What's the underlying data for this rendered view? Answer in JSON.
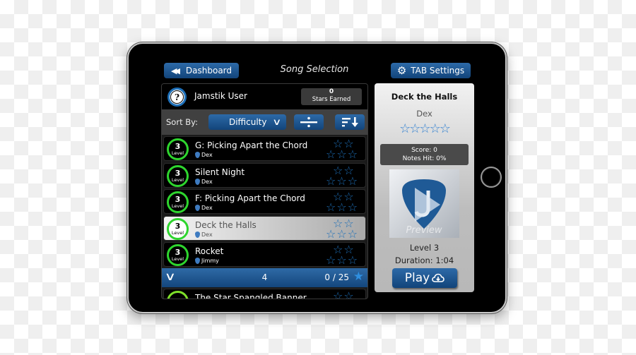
{
  "header": {
    "back_label": "Dashboard",
    "title": "Song Selection",
    "settings_label": "TAB Settings"
  },
  "user": {
    "name": "Jamstik User",
    "stars_earned_count": "0",
    "stars_earned_label": "Stars Earned"
  },
  "sort": {
    "label": "Sort By:",
    "selected": "Difficulty"
  },
  "songs": [
    {
      "level": "3",
      "level_label": "Level",
      "title": "G: Picking Apart the Chord",
      "artist": "Dex",
      "stars": 0,
      "selected": false
    },
    {
      "level": "3",
      "level_label": "Level",
      "title": "Silent Night",
      "artist": "Dex",
      "stars": 0,
      "selected": false
    },
    {
      "level": "3",
      "level_label": "Level",
      "title": "F: Picking Apart the Chord",
      "artist": "Dex",
      "stars": 0,
      "selected": false
    },
    {
      "level": "3",
      "level_label": "Level",
      "title": "Deck the Halls",
      "artist": "Dex",
      "stars": 0,
      "selected": true
    },
    {
      "level": "3",
      "level_label": "Level",
      "title": "Rocket",
      "artist": "Jimmy",
      "stars": 0,
      "selected": false
    }
  ],
  "page_bar": {
    "page": "4",
    "stars_count": "0 / 25"
  },
  "next_song_partial": {
    "title": "The Star Spangled Banner"
  },
  "detail": {
    "title": "Deck the Halls",
    "artist": "Dex",
    "stars": 0,
    "score": "Score: 0",
    "notes_hit": "Notes Hit: 0%",
    "preview_label": "Preview",
    "level": "Level 3",
    "duration": "Duration: 1:04",
    "play_label": "Play"
  },
  "colors": {
    "accent_blue": "#1d6fb8",
    "level_ring": "#2ed52e",
    "button_blue": "#1f5a96"
  }
}
